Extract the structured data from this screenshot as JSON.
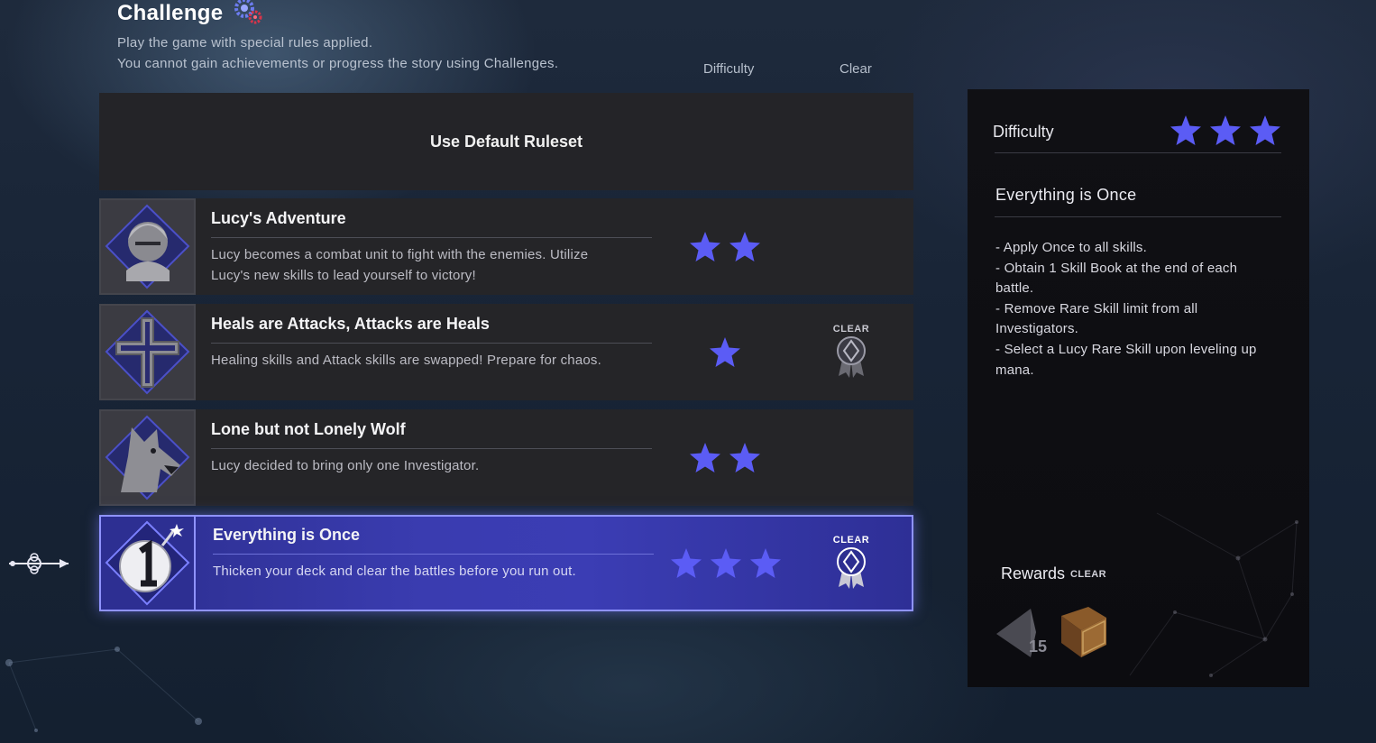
{
  "header": {
    "title": "Challenge",
    "subtitle_line1": "Play the game with special rules applied.",
    "subtitle_line2": "You cannot gain achievements or progress the story using Challenges."
  },
  "columns": {
    "difficulty": "Difficulty",
    "clear": "Clear"
  },
  "default_ruleset_label": "Use Default Ruleset",
  "challenges": [
    {
      "name": "Lucy's Adventure",
      "desc_line1": "Lucy becomes a combat unit to fight with the enemies. Utilize",
      "desc_line2": "Lucy's new skills to lead yourself to victory!",
      "difficulty": 2,
      "cleared": false,
      "icon": "lucy-portrait-icon"
    },
    {
      "name": "Heals are Attacks, Attacks are Heals",
      "desc_line1": "Healing skills and Attack skills are swapped! Prepare for chaos.",
      "desc_line2": "",
      "difficulty": 1,
      "cleared": true,
      "clear_label": "CLEAR",
      "icon": "cross-icon"
    },
    {
      "name": "Lone but not Lonely Wolf",
      "desc_line1": "Lucy decided to bring only one Investigator.",
      "desc_line2": "",
      "difficulty": 2,
      "cleared": false,
      "icon": "wolf-icon"
    },
    {
      "name": "Everything is Once",
      "desc_line1": "Thicken your deck and clear the battles before you run out.",
      "desc_line2": "",
      "difficulty": 3,
      "cleared": true,
      "clear_label": "CLEAR",
      "icon": "bomb-number-one-icon",
      "selected": true
    }
  ],
  "detail": {
    "difficulty_label": "Difficulty",
    "difficulty": 3,
    "title": "Everything is Once",
    "rules": [
      "- Apply Once to all skills.",
      "- Obtain 1 Skill Book at the end of each battle.",
      "- Remove Rare Skill limit from all Investigators.",
      "- Select a Lucy Rare Skill upon leveling up mana."
    ],
    "rewards_label": "Rewards",
    "rewards_tag": "CLEAR",
    "reward_count": "15"
  },
  "colors": {
    "star": "#5b5cf5",
    "selected_row": "#3a3cb0",
    "selected_border": "#8f93ff"
  }
}
